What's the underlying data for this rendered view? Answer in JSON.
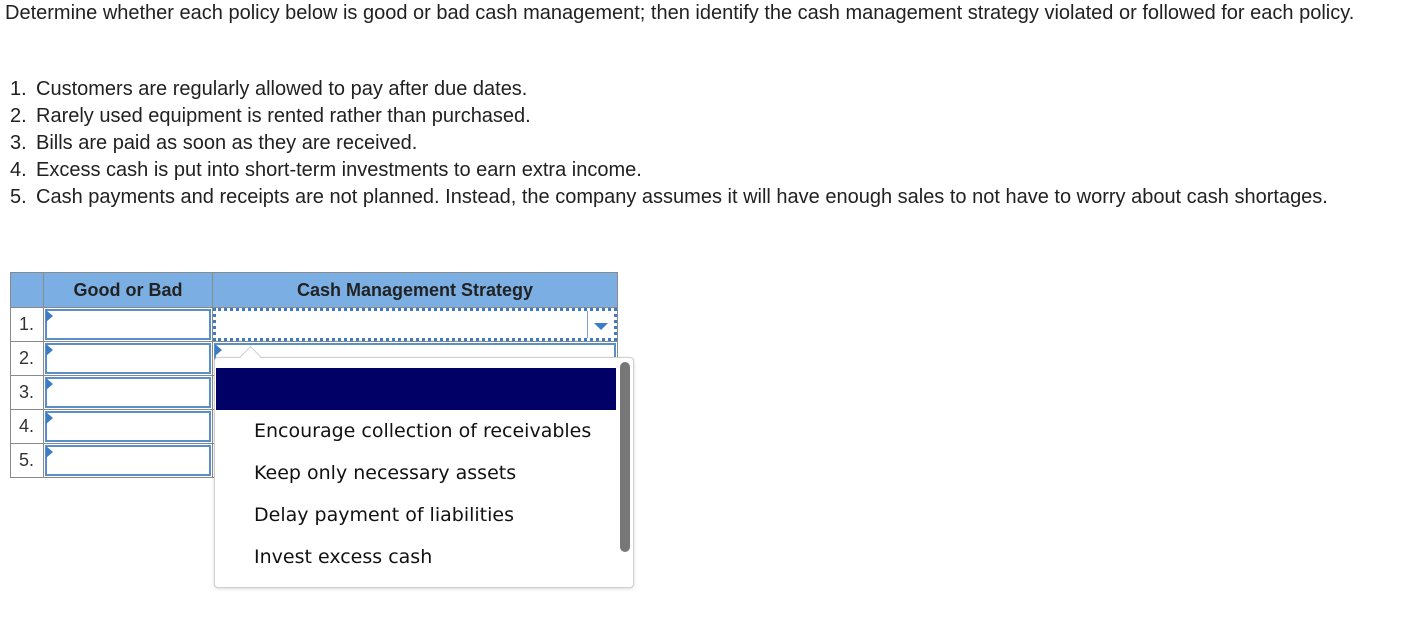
{
  "instructions": "Determine whether each policy below is good or bad cash management; then identify the cash management strategy violated or followed for each policy.",
  "policies": [
    {
      "num": "1.",
      "text": "Customers are regularly allowed to pay after due dates."
    },
    {
      "num": "2.",
      "text": "Rarely used equipment is rented rather than purchased."
    },
    {
      "num": "3.",
      "text": "Bills are paid as soon as they are received."
    },
    {
      "num": "4.",
      "text": "Excess cash is put into short-term investments to earn extra income."
    },
    {
      "num": "5.",
      "text": "Cash payments and receipts are not planned. Instead, the company assumes it will have enough sales to not have to worry about cash shortages."
    }
  ],
  "table": {
    "headers": {
      "good_or_bad": "Good or Bad",
      "strategy": "Cash Management Strategy"
    },
    "rows": [
      {
        "num": "1.",
        "good_or_bad": "",
        "strategy": ""
      },
      {
        "num": "2.",
        "good_or_bad": "",
        "strategy": ""
      },
      {
        "num": "3.",
        "good_or_bad": "",
        "strategy": ""
      },
      {
        "num": "4.",
        "good_or_bad": "",
        "strategy": ""
      },
      {
        "num": "5.",
        "good_or_bad": "",
        "strategy": ""
      }
    ]
  },
  "dropdown": {
    "options": [
      "",
      "Encourage collection of receivables",
      "Keep only necessary assets",
      "Delay payment of liabilities",
      "Invest excess cash"
    ],
    "selected_index": 0,
    "highlight_color": "#000066"
  }
}
